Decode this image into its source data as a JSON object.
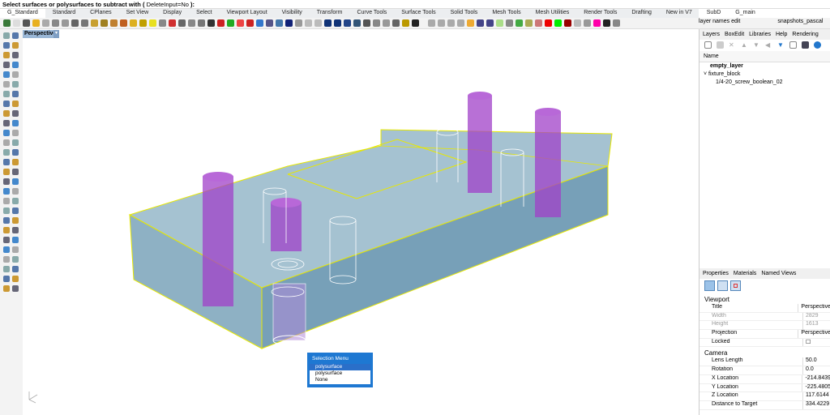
{
  "command_prompt": {
    "text": "Select surfaces or polysurfaces to subtract with (",
    "option": "DeleteInput=No",
    "end": "):"
  },
  "tabs": [
    "G_Standard",
    "Standard",
    "CPlanes",
    "Set View",
    "Display",
    "Select",
    "Viewport Layout",
    "Visibility",
    "Transform",
    "Curve Tools",
    "Surface Tools",
    "Solid Tools",
    "Mesh Tools",
    "Mesh Utilities",
    "Render Tools",
    "Drafting",
    "New in V7",
    "SubD",
    "G_main"
  ],
  "toolbar_right": {
    "layer_names_edit": "layer names edit",
    "snapshots": "snapshots_pascal"
  },
  "viewport": {
    "title": "Perspective"
  },
  "layers_panel": {
    "tabs": [
      "Layers",
      "BoxEdit",
      "Libraries",
      "Help",
      "Rendering"
    ],
    "column": "Name",
    "items": [
      {
        "name": "empty_layer"
      },
      {
        "name": "fixture_block"
      },
      {
        "name": "1/4-20_screw_boolean_02"
      }
    ]
  },
  "properties_panel": {
    "tabs": [
      "Properties",
      "Materials",
      "Named Views"
    ],
    "viewport_section": "Viewport",
    "viewport_rows": [
      {
        "k": "Title",
        "v": "Perspective"
      },
      {
        "k": "Width",
        "v": "2829"
      },
      {
        "k": "Height",
        "v": "1613"
      },
      {
        "k": "Projection",
        "v": "Perspective"
      },
      {
        "k": "Locked",
        "v": "☐"
      }
    ],
    "camera_section": "Camera",
    "camera_rows": [
      {
        "k": "Lens Length",
        "v": "50.0"
      },
      {
        "k": "Rotation",
        "v": "0.0"
      },
      {
        "k": "X Location",
        "v": "-214.8439"
      },
      {
        "k": "Y Location",
        "v": "-225.4805"
      },
      {
        "k": "Z Location",
        "v": "117.6144"
      },
      {
        "k": "Distance to Target",
        "v": "334.4229"
      }
    ]
  },
  "selection_menu": {
    "title": "Selection Menu",
    "items": [
      "polysurface",
      "polysurface",
      "None"
    ],
    "selected": 0
  },
  "colors": {
    "accent": "#1e78d2",
    "box": "#6e9bb5",
    "edge": "#e8e800",
    "purple": "#a040c8"
  }
}
